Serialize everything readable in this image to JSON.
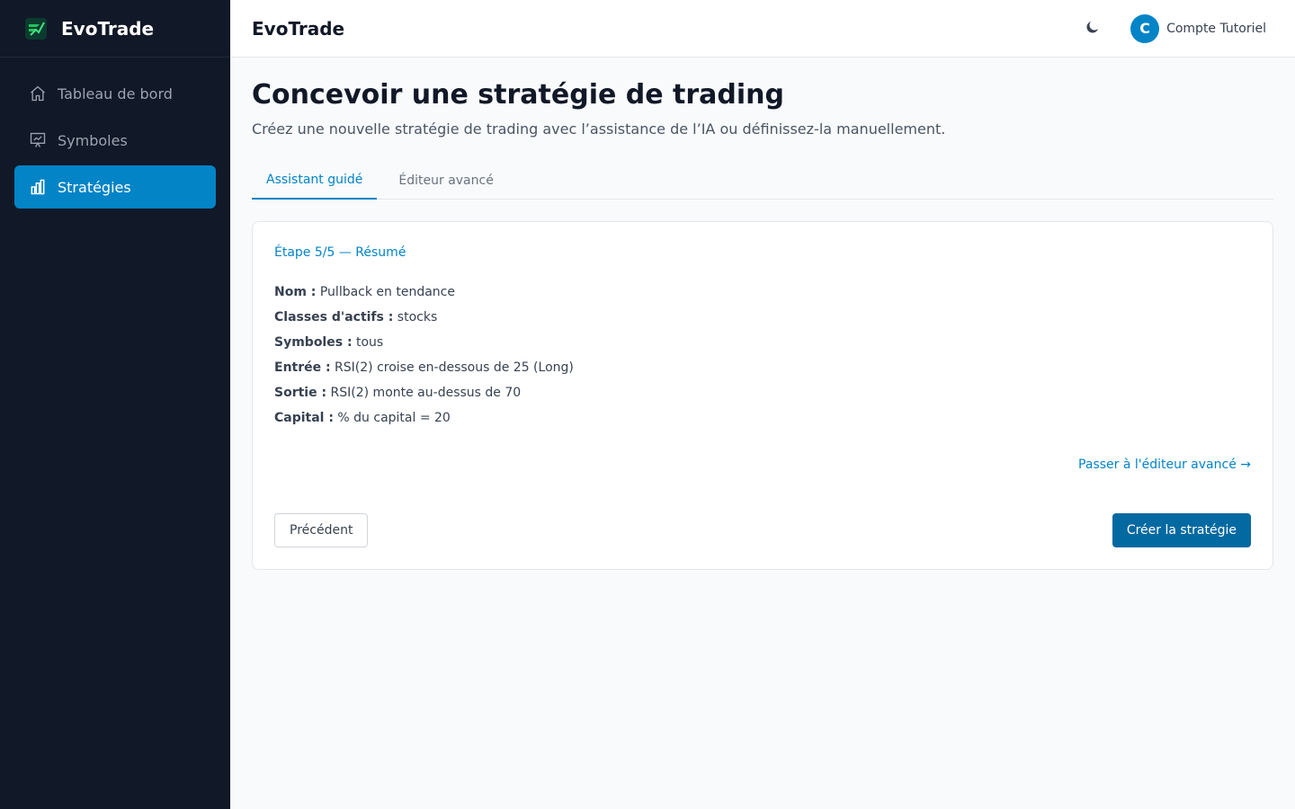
{
  "app": {
    "name": "EvoTrade"
  },
  "colors": {
    "sidebar_bg": "#111827",
    "accent": "#0284c7",
    "primary_button": "#0369a1"
  },
  "sidebar": {
    "items": [
      {
        "label": "Tableau de bord",
        "icon": "home-icon",
        "active": false
      },
      {
        "label": "Symboles",
        "icon": "presentation-chart-icon",
        "active": false
      },
      {
        "label": "Stratégies",
        "icon": "bar-chart-icon",
        "active": true
      }
    ]
  },
  "header": {
    "title": "EvoTrade",
    "theme_icon": "moon-icon",
    "user": {
      "initial": "C",
      "name": "Compte Tutoriel"
    }
  },
  "page": {
    "title": "Concevoir une stratégie de trading",
    "subtitle": "Créez une nouvelle stratégie de trading avec l’assistance de l’IA ou définissez-la manuellement."
  },
  "tabs": [
    {
      "label": "Assistant guidé",
      "active": true
    },
    {
      "label": "Éditeur avancé",
      "active": false
    }
  ],
  "wizard": {
    "step_label": "Étape 5/5 — Résumé",
    "summary": [
      {
        "key": "Nom :",
        "value": "Pullback en tendance"
      },
      {
        "key": "Classes d'actifs :",
        "value": "stocks"
      },
      {
        "key": "Symboles :",
        "value": "tous"
      },
      {
        "key": "Entrée :",
        "value": "RSI(2) croise en-dessous de 25 (Long)"
      },
      {
        "key": "Sortie :",
        "value": "RSI(2) monte au-dessus de 70"
      },
      {
        "key": "Capital :",
        "value": "% du capital = 20"
      }
    ],
    "advanced_link": "Passer à l'éditeur avancé →",
    "prev_button": "Précédent",
    "create_button": "Créer la stratégie"
  }
}
